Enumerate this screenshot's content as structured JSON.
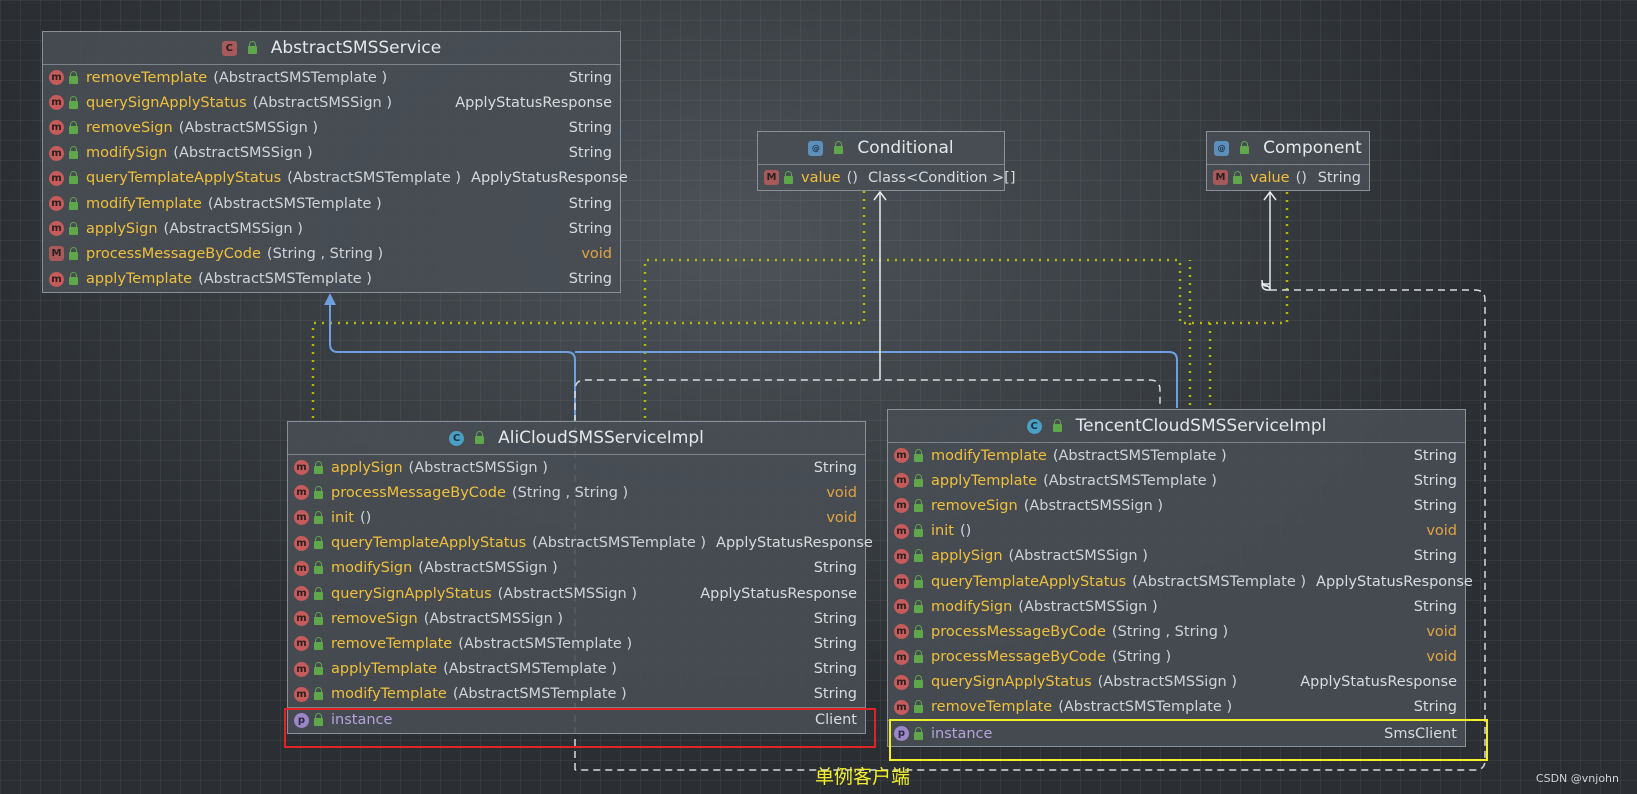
{
  "classes": {
    "abstract": {
      "name": "AbstractSMSService",
      "methods": [
        {
          "name": "removeTemplate",
          "params": "(AbstractSMSTemplate )",
          "ret": "String"
        },
        {
          "name": "querySignApplyStatus",
          "params": "(AbstractSMSSign )",
          "ret": "ApplyStatusResponse"
        },
        {
          "name": "removeSign",
          "params": "(AbstractSMSSign )",
          "ret": "String"
        },
        {
          "name": "modifySign",
          "params": "(AbstractSMSSign )",
          "ret": "String"
        },
        {
          "name": "queryTemplateApplyStatus",
          "params": "(AbstractSMSTemplate )",
          "ret": "ApplyStatusResponse"
        },
        {
          "name": "modifyTemplate",
          "params": "(AbstractSMSTemplate )",
          "ret": "String"
        },
        {
          "name": "applySign",
          "params": "(AbstractSMSSign )",
          "ret": "String"
        },
        {
          "name": "processMessageByCode",
          "params": "(String , String )",
          "ret": "void"
        },
        {
          "name": "applyTemplate",
          "params": "(AbstractSMSTemplate )",
          "ret": "String"
        }
      ]
    },
    "conditional": {
      "name": "Conditional",
      "methods": [
        {
          "name": "value",
          "params": "()",
          "ret": "Class<Condition >[]"
        }
      ]
    },
    "component": {
      "name": "Component",
      "methods": [
        {
          "name": "value",
          "params": "()",
          "ret": "String"
        }
      ]
    },
    "ali": {
      "name": "AliCloudSMSServiceImpl",
      "methods": [
        {
          "name": "applySign",
          "params": "(AbstractSMSSign )",
          "ret": "String"
        },
        {
          "name": "processMessageByCode",
          "params": "(String , String )",
          "ret": "void"
        },
        {
          "name": "init",
          "params": "()",
          "ret": "void"
        },
        {
          "name": "queryTemplateApplyStatus",
          "params": "(AbstractSMSTemplate )",
          "ret": "ApplyStatusResponse"
        },
        {
          "name": "modifySign",
          "params": "(AbstractSMSSign )",
          "ret": "String"
        },
        {
          "name": "querySignApplyStatus",
          "params": "(AbstractSMSSign )",
          "ret": "ApplyStatusResponse"
        },
        {
          "name": "removeSign",
          "params": "(AbstractSMSSign )",
          "ret": "String"
        },
        {
          "name": "removeTemplate",
          "params": "(AbstractSMSTemplate )",
          "ret": "String"
        },
        {
          "name": "applyTemplate",
          "params": "(AbstractSMSTemplate )",
          "ret": "String"
        },
        {
          "name": "modifyTemplate",
          "params": "(AbstractSMSTemplate )",
          "ret": "String"
        }
      ],
      "field": {
        "name": "instance",
        "type": "Client"
      }
    },
    "tencent": {
      "name": "TencentCloudSMSServiceImpl",
      "methods": [
        {
          "name": "modifyTemplate",
          "params": "(AbstractSMSTemplate )",
          "ret": "String"
        },
        {
          "name": "applyTemplate",
          "params": "(AbstractSMSTemplate )",
          "ret": "String"
        },
        {
          "name": "removeSign",
          "params": "(AbstractSMSSign )",
          "ret": "String"
        },
        {
          "name": "init",
          "params": "()",
          "ret": "void"
        },
        {
          "name": "applySign",
          "params": "(AbstractSMSSign )",
          "ret": "String"
        },
        {
          "name": "queryTemplateApplyStatus",
          "params": "(AbstractSMSTemplate )",
          "ret": "ApplyStatusResponse"
        },
        {
          "name": "modifySign",
          "params": "(AbstractSMSSign )",
          "ret": "String"
        },
        {
          "name": "processMessageByCode",
          "params": "(String , String )",
          "ret": "void"
        },
        {
          "name": "processMessageByCode",
          "params": "(String )",
          "ret": "void"
        },
        {
          "name": "querySignApplyStatus",
          "params": "(AbstractSMSSign )",
          "ret": "ApplyStatusResponse"
        },
        {
          "name": "removeTemplate",
          "params": "(AbstractSMSTemplate )",
          "ret": "String"
        }
      ],
      "field": {
        "name": "instance",
        "type": "SmsClient"
      }
    }
  },
  "caption": "单例客户端",
  "watermark": "CSDN @vnjohn",
  "colors": {
    "method": "#f0c03a",
    "void": "#e2a541",
    "property": "#b5a3dc",
    "highlight_red": "#e02424",
    "highlight_yellow": "#f2ee2a"
  }
}
